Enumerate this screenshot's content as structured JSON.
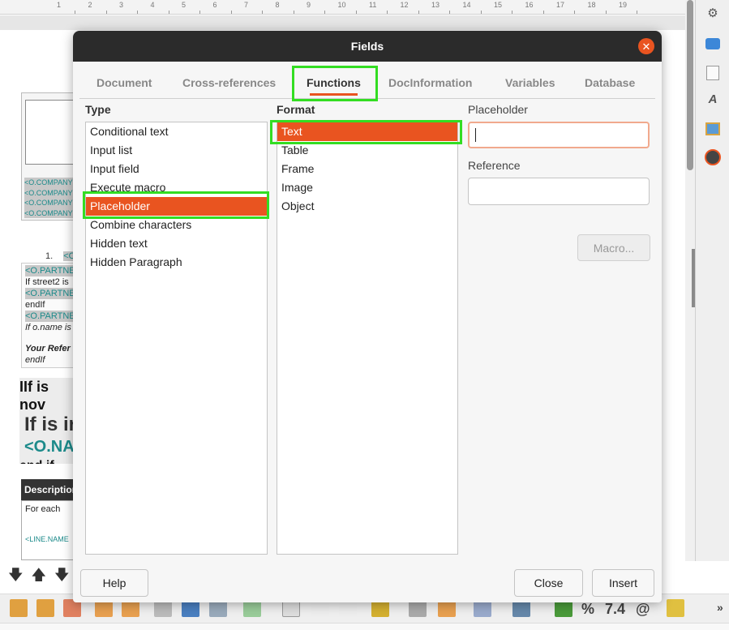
{
  "dialog": {
    "title": "Fields",
    "tabs": [
      "Document",
      "Cross-references",
      "Functions",
      "DocInformation",
      "Variables",
      "Database"
    ],
    "active_tab": "Functions",
    "type_label": "Type",
    "type_items": [
      "Conditional text",
      "Input list",
      "Input field",
      "Execute macro",
      "Placeholder",
      "Combine characters",
      "Hidden text",
      "Hidden Paragraph"
    ],
    "type_selected": "Placeholder",
    "format_label": "Format",
    "format_items": [
      "Text",
      "Table",
      "Frame",
      "Image",
      "Object"
    ],
    "format_selected": "Text",
    "placeholder_label": "Placeholder",
    "placeholder_value": "",
    "reference_label": "Reference",
    "reference_value": "",
    "macro_button": "Macro...",
    "help_button": "Help",
    "close_button": "Close",
    "insert_button": "Insert",
    "accent_color": "#e95420",
    "highlight_color": "#33dd22"
  },
  "ruler": {
    "numbers": [
      "1",
      "2",
      "3",
      "4",
      "5",
      "6",
      "7",
      "8",
      "9",
      "10",
      "11",
      "12",
      "13",
      "14",
      "15",
      "16",
      "17",
      "18",
      "19"
    ]
  },
  "document": {
    "company_lines": [
      "<O.COMPANY",
      "<O.COMPANY",
      "<O.COMPANY",
      "<O.COMPANY"
    ],
    "list_number": "1.",
    "partner_1": "<O.PARTNER",
    "if_street2": "If street2 is",
    "partner_2": "<O.PARTNER",
    "endif_1": "endIf",
    "partner_3": "<O.PARTNER",
    "if_oname": "If o.name is",
    "your_ref": "Your Refer",
    "endif_2": "endIf",
    "ifis_now": "IIf is nov",
    "ifis_in": "If is ir",
    "oname": "<O.NA",
    "end_if": "end if",
    "description": "Description",
    "for_each": "For each",
    "line_name": "<LINE.NAME"
  },
  "toolbar": {
    "percent": "%",
    "number": "7.4",
    "at": "@"
  }
}
